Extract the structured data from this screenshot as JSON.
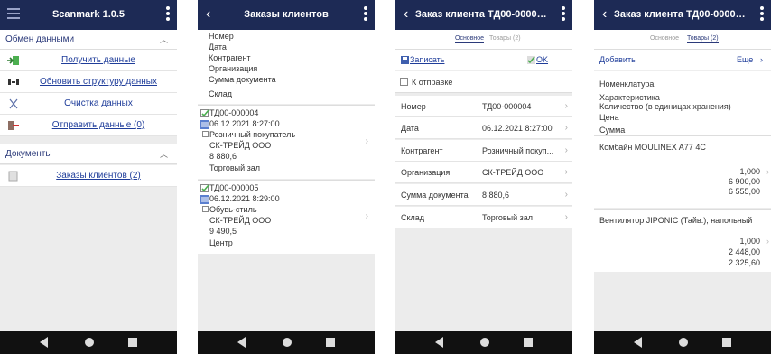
{
  "screen1": {
    "title": "Scanmark 1.0.5",
    "section_exchange": "Обмен данными",
    "actions": [
      {
        "label": "Получить данные",
        "icon": "download-icon"
      },
      {
        "label": "Обновить структуру данных",
        "icon": "update-structure-icon"
      },
      {
        "label": "Очистка данных",
        "icon": "clear-icon"
      },
      {
        "label": "Отправить данные (0)",
        "icon": "upload-icon"
      }
    ],
    "section_documents": "Документы",
    "documents": [
      {
        "label": "Заказы клиентов (2)",
        "icon": "document-icon"
      }
    ]
  },
  "screen2": {
    "title": "Заказы клиентов",
    "header_fields": [
      "Номер",
      "Дата",
      "Контрагент",
      "Организация",
      "Сумма документа",
      "Склад"
    ],
    "orders": [
      {
        "number": "ТД00-000004",
        "date": "06.12.2021 8:27:00",
        "partner": "Розничный покупатель",
        "org": "СК-ТРЕЙД ООО",
        "sum": "8 880,6",
        "warehouse": "Торговый зал"
      },
      {
        "number": "ТД00-000005",
        "date": "06.12.2021 8:29:00",
        "partner": "Обувь-стиль",
        "org": "СК-ТРЕЙД ООО",
        "sum": "9 490,5",
        "warehouse": "Центр"
      }
    ]
  },
  "screen3": {
    "title": "Заказ клиента ТД00-000004 0...",
    "tab_main": "Основное",
    "tab_goods": "Товары (2)",
    "save": "Записать",
    "ok": "OK",
    "checkbox": "К отправке",
    "fields": [
      {
        "key": "Номер",
        "value": "ТД00-000004"
      },
      {
        "key": "Дата",
        "value": "06.12.2021 8:27:00"
      },
      {
        "key": "Контрагент",
        "value": "Розничный покуп..."
      },
      {
        "key": "Организация",
        "value": "СК-ТРЕЙД ООО"
      },
      {
        "key": "Сумма документа",
        "value": "8 880,6"
      },
      {
        "key": "Склад",
        "value": "Торговый зал"
      }
    ]
  },
  "screen4": {
    "title": "Заказ клиента ТД00-000004 0...",
    "tab_main": "Основное",
    "tab_goods": "Товары (2)",
    "add": "Добавить",
    "more": "Еще",
    "header_fields": [
      "Номенклатура",
      "Характеристика",
      "Количество (в единицах хранения)",
      "Цена",
      "Сумма"
    ],
    "products": [
      {
        "name": "Комбайн MOULINEX A77 4C",
        "qty": "1,000",
        "price": "6 900,00",
        "sum": "6 555,00"
      },
      {
        "name": "Вентилятор JIPONIC (Тайв.), напольный",
        "qty": "1,000",
        "price": "2 448,00",
        "sum": "2 325,60"
      }
    ]
  },
  "colors": {
    "appbar": "#1d2a55",
    "link": "#1f3d9a",
    "background": "#ececec",
    "navbar": "#111111"
  }
}
